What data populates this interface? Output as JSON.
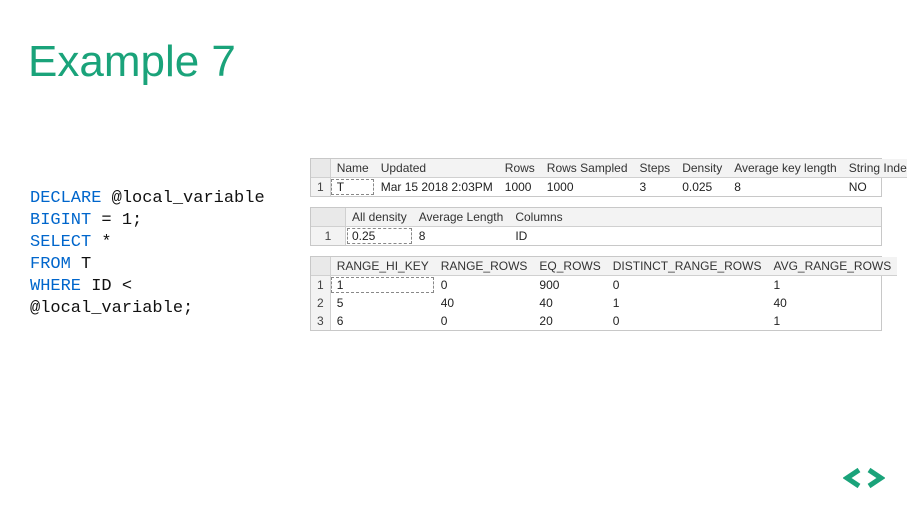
{
  "title": "Example 7",
  "code": {
    "kw_declare": "DECLARE",
    "var1": " @local_variable",
    "kw_bigint": "BIGINT",
    "eq1": " = 1;",
    "kw_select": "SELECT",
    "star": " *",
    "kw_from": "FROM",
    "tbl": " T",
    "kw_where": "WHERE",
    "idlt": " ID <",
    "var2": "@local_variable;"
  },
  "grid1": {
    "headers": [
      "Name",
      "Updated",
      "Rows",
      "Rows Sampled",
      "Steps",
      "Density",
      "Average key length",
      "String Index"
    ],
    "rows": [
      {
        "idx": "1",
        "cells": [
          "T",
          "Mar 15 2018  2:03PM",
          "1000",
          "1000",
          "3",
          "0.025",
          "8",
          "NO"
        ]
      }
    ]
  },
  "grid2": {
    "headers": [
      "All density",
      "Average Length",
      "Columns"
    ],
    "rows": [
      {
        "idx": "1",
        "cells": [
          "0.25",
          "8",
          "ID"
        ]
      }
    ]
  },
  "grid3": {
    "headers": [
      "RANGE_HI_KEY",
      "RANGE_ROWS",
      "EQ_ROWS",
      "DISTINCT_RANGE_ROWS",
      "AVG_RANGE_ROWS"
    ],
    "rows": [
      {
        "idx": "1",
        "cells": [
          "1",
          "0",
          "900",
          "0",
          "1"
        ]
      },
      {
        "idx": "2",
        "cells": [
          "5",
          "40",
          "40",
          "1",
          "40"
        ]
      },
      {
        "idx": "3",
        "cells": [
          "6",
          "0",
          "20",
          "0",
          "1"
        ]
      }
    ]
  }
}
